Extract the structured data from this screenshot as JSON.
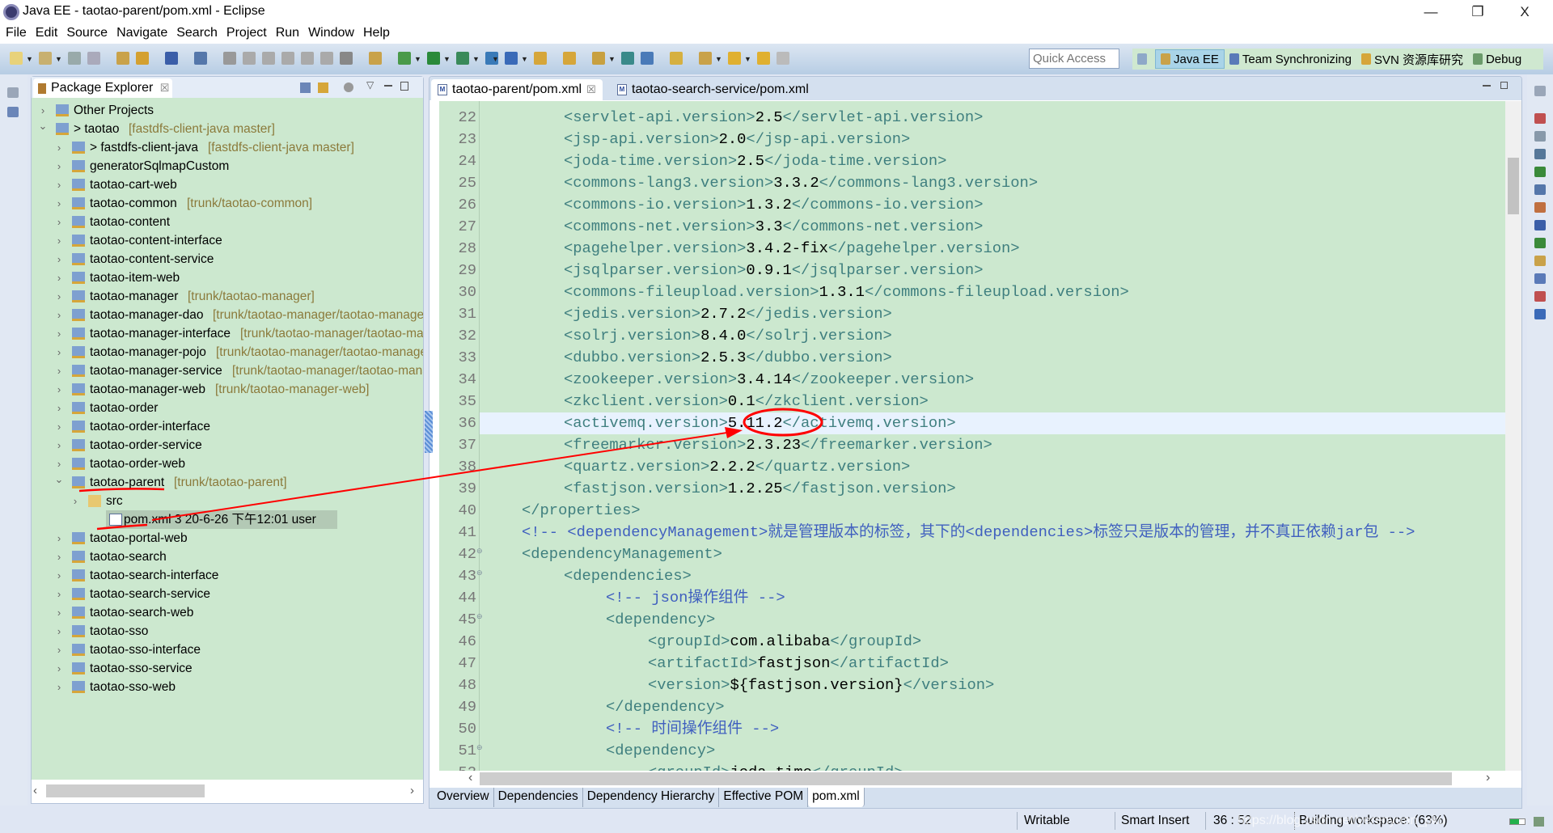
{
  "window": {
    "title": "Java EE - taotao-parent/pom.xml - Eclipse",
    "minimize": "—",
    "restore": "❐",
    "close": "X"
  },
  "menu": [
    "File",
    "Edit",
    "Source",
    "Navigate",
    "Search",
    "Project",
    "Run",
    "Window",
    "Help"
  ],
  "toolbar": {
    "quick_access_placeholder": "Quick Access",
    "perspectives": [
      {
        "label": "Java EE",
        "active": true
      },
      {
        "label": "Team Synchronizing"
      },
      {
        "label": "SVN 资源库研究"
      },
      {
        "label": "Debug"
      }
    ]
  },
  "package_explorer": {
    "title": "Package Explorer",
    "close": "☒",
    "items": [
      {
        "label": "Other Projects",
        "level": 0,
        "expanded": false
      },
      {
        "label": "> taotao",
        "deco": "[fastdfs-client-java master]",
        "level": 0,
        "expanded": true
      },
      {
        "label": "> fastdfs-client-java",
        "deco": "[fastdfs-client-java master]",
        "level": 1
      },
      {
        "label": "generatorSqlmapCustom",
        "level": 1
      },
      {
        "label": "taotao-cart-web",
        "level": 1
      },
      {
        "label": "taotao-common",
        "deco": "[trunk/taotao-common]",
        "level": 1
      },
      {
        "label": "taotao-content",
        "level": 1
      },
      {
        "label": "taotao-content-interface",
        "level": 1
      },
      {
        "label": "taotao-content-service",
        "level": 1
      },
      {
        "label": "taotao-item-web",
        "level": 1
      },
      {
        "label": "taotao-manager",
        "deco": "[trunk/taotao-manager]",
        "level": 1
      },
      {
        "label": "taotao-manager-dao",
        "deco": "[trunk/taotao-manager/taotao-manager-dao]",
        "level": 1
      },
      {
        "label": "taotao-manager-interface",
        "deco": "[trunk/taotao-manager/taotao-manager-interface]",
        "level": 1
      },
      {
        "label": "taotao-manager-pojo",
        "deco": "[trunk/taotao-manager/taotao-manager-pojo]",
        "level": 1
      },
      {
        "label": "taotao-manager-service",
        "deco": "[trunk/taotao-manager/taotao-manager-service]",
        "level": 1
      },
      {
        "label": "taotao-manager-web",
        "deco": "[trunk/taotao-manager-web]",
        "level": 1
      },
      {
        "label": "taotao-order",
        "level": 1
      },
      {
        "label": "taotao-order-interface",
        "level": 1
      },
      {
        "label": "taotao-order-service",
        "level": 1
      },
      {
        "label": "taotao-order-web",
        "level": 1
      },
      {
        "label": "taotao-parent",
        "deco": "[trunk/taotao-parent]",
        "level": 1,
        "expanded": true
      },
      {
        "label": "src",
        "level": 2,
        "type": "folder"
      },
      {
        "label": "pom.xml 3  20-6-26 下午12:01  user",
        "level": 2,
        "type": "file",
        "selected": true
      },
      {
        "label": "taotao-portal-web",
        "level": 1
      },
      {
        "label": "taotao-search",
        "level": 1
      },
      {
        "label": "taotao-search-interface",
        "level": 1
      },
      {
        "label": "taotao-search-service",
        "level": 1
      },
      {
        "label": "taotao-search-web",
        "level": 1
      },
      {
        "label": "taotao-sso",
        "level": 1
      },
      {
        "label": "taotao-sso-interface",
        "level": 1
      },
      {
        "label": "taotao-sso-service",
        "level": 1
      },
      {
        "label": "taotao-sso-web",
        "level": 1
      }
    ]
  },
  "editor": {
    "tabs": [
      {
        "label": "taotao-parent/pom.xml",
        "active": true,
        "close": "☒"
      },
      {
        "label": "taotao-search-service/pom.xml"
      }
    ],
    "current_line": 36,
    "lines": [
      {
        "n": 22,
        "tokens": [
          [
            "t",
            "\t\t<servlet-api.version>"
          ],
          [
            "v",
            "2.5"
          ],
          [
            "t",
            "</servlet-api.version>"
          ]
        ]
      },
      {
        "n": 23,
        "tokens": [
          [
            "t",
            "\t\t<jsp-api.version>"
          ],
          [
            "v",
            "2.0"
          ],
          [
            "t",
            "</jsp-api.version>"
          ]
        ]
      },
      {
        "n": 24,
        "tokens": [
          [
            "t",
            "\t\t<joda-time.version>"
          ],
          [
            "v",
            "2.5"
          ],
          [
            "t",
            "</joda-time.version>"
          ]
        ]
      },
      {
        "n": 25,
        "tokens": [
          [
            "t",
            "\t\t<commons-lang3.version>"
          ],
          [
            "v",
            "3.3.2"
          ],
          [
            "t",
            "</commons-lang3.version>"
          ]
        ]
      },
      {
        "n": 26,
        "tokens": [
          [
            "t",
            "\t\t<commons-io.version>"
          ],
          [
            "v",
            "1.3.2"
          ],
          [
            "t",
            "</commons-io.version>"
          ]
        ]
      },
      {
        "n": 27,
        "tokens": [
          [
            "t",
            "\t\t<commons-net.version>"
          ],
          [
            "v",
            "3.3"
          ],
          [
            "t",
            "</commons-net.version>"
          ]
        ]
      },
      {
        "n": 28,
        "tokens": [
          [
            "t",
            "\t\t<pagehelper.version>"
          ],
          [
            "v",
            "3.4.2-fix"
          ],
          [
            "t",
            "</pagehelper.version>"
          ]
        ]
      },
      {
        "n": 29,
        "tokens": [
          [
            "t",
            "\t\t<jsqlparser.version>"
          ],
          [
            "v",
            "0.9.1"
          ],
          [
            "t",
            "</jsqlparser.version>"
          ]
        ]
      },
      {
        "n": 30,
        "tokens": [
          [
            "t",
            "\t\t<commons-fileupload.version>"
          ],
          [
            "v",
            "1.3.1"
          ],
          [
            "t",
            "</commons-fileupload.version>"
          ]
        ]
      },
      {
        "n": 31,
        "tokens": [
          [
            "t",
            "\t\t<jedis.version>"
          ],
          [
            "v",
            "2.7.2"
          ],
          [
            "t",
            "</jedis.version>"
          ]
        ]
      },
      {
        "n": 32,
        "tokens": [
          [
            "t",
            "\t\t<solrj.version>"
          ],
          [
            "v",
            "8.4.0"
          ],
          [
            "t",
            "</solrj.version>"
          ]
        ]
      },
      {
        "n": 33,
        "tokens": [
          [
            "t",
            "\t\t<dubbo.version>"
          ],
          [
            "v",
            "2.5.3"
          ],
          [
            "t",
            "</dubbo.version>"
          ]
        ]
      },
      {
        "n": 34,
        "tokens": [
          [
            "t",
            "\t\t<zookeeper.version>"
          ],
          [
            "v",
            "3.4.14"
          ],
          [
            "t",
            "</zookeeper.version>"
          ]
        ]
      },
      {
        "n": 35,
        "tokens": [
          [
            "t",
            "\t\t<zkclient.version>"
          ],
          [
            "v",
            "0.1"
          ],
          [
            "t",
            "</zkclient.version>"
          ]
        ]
      },
      {
        "n": 36,
        "tokens": [
          [
            "t",
            "\t\t<activemq.version>"
          ],
          [
            "v",
            "5.11.2"
          ],
          [
            "t",
            "</activemq.version>"
          ]
        ]
      },
      {
        "n": 37,
        "tokens": [
          [
            "t",
            "\t\t<freemarker.version>"
          ],
          [
            "v",
            "2.3.23"
          ],
          [
            "t",
            "</freemarker.version>"
          ]
        ]
      },
      {
        "n": 38,
        "tokens": [
          [
            "t",
            "\t\t<quartz.version>"
          ],
          [
            "v",
            "2.2.2"
          ],
          [
            "t",
            "</quartz.version>"
          ]
        ]
      },
      {
        "n": 39,
        "tokens": [
          [
            "t",
            "\t\t<fastjson.version>"
          ],
          [
            "v",
            "1.2.25"
          ],
          [
            "t",
            "</fastjson.version>"
          ]
        ]
      },
      {
        "n": 40,
        "tokens": [
          [
            "t",
            "\t</properties>"
          ]
        ]
      },
      {
        "n": 41,
        "tokens": [
          [
            "c",
            "\t<!-- <dependencyManagement>就是管理版本的标签，其下的<dependencies>标签只是版本的管理，并不真正依赖jar包 -->"
          ]
        ]
      },
      {
        "n": 42,
        "fold": true,
        "tokens": [
          [
            "t",
            "\t<dependencyManagement>"
          ]
        ]
      },
      {
        "n": 43,
        "fold": true,
        "tokens": [
          [
            "t",
            "\t\t<dependencies>"
          ]
        ]
      },
      {
        "n": 44,
        "tokens": [
          [
            "c",
            "\t\t\t<!-- json操作组件 -->"
          ]
        ]
      },
      {
        "n": 45,
        "fold": true,
        "tokens": [
          [
            "t",
            "\t\t\t<dependency>"
          ]
        ]
      },
      {
        "n": 46,
        "tokens": [
          [
            "t",
            "\t\t\t\t<groupId>"
          ],
          [
            "v",
            "com.alibaba"
          ],
          [
            "t",
            "</groupId>"
          ]
        ]
      },
      {
        "n": 47,
        "tokens": [
          [
            "t",
            "\t\t\t\t<artifactId>"
          ],
          [
            "v",
            "fastjson"
          ],
          [
            "t",
            "</artifactId>"
          ]
        ]
      },
      {
        "n": 48,
        "tokens": [
          [
            "t",
            "\t\t\t\t<version>"
          ],
          [
            "v",
            "${fastjson.version}"
          ],
          [
            "t",
            "</version>"
          ]
        ]
      },
      {
        "n": 49,
        "tokens": [
          [
            "t",
            "\t\t\t</dependency>"
          ]
        ]
      },
      {
        "n": 50,
        "tokens": [
          [
            "c",
            "\t\t\t<!-- 时间操作组件 -->"
          ]
        ]
      },
      {
        "n": 51,
        "fold": true,
        "tokens": [
          [
            "t",
            "\t\t\t<dependency>"
          ]
        ]
      },
      {
        "n": 52,
        "tokens": [
          [
            "t",
            "\t\t\t\t<groupId>"
          ],
          [
            "v",
            "joda-time"
          ],
          [
            "t",
            "</groupId>"
          ]
        ]
      }
    ],
    "bottom_tabs": [
      {
        "label": "Overview"
      },
      {
        "label": "Dependencies"
      },
      {
        "label": "Dependency Hierarchy"
      },
      {
        "label": "Effective POM"
      },
      {
        "label": "pom.xml",
        "active": true
      }
    ]
  },
  "status": {
    "writable": "Writable",
    "insert_mode": "Smart Insert",
    "position": "36 : 52",
    "progress_text": "Building workspace: (63%)",
    "progress_percent": 63,
    "watermark": "https://blog.csdn.net/yerenyuan_pku"
  },
  "colors": {
    "editor_bg": "#cce8cf",
    "tag": "#3f7f7f",
    "comment": "#3f5fbf",
    "annotation": "#ff0000"
  }
}
